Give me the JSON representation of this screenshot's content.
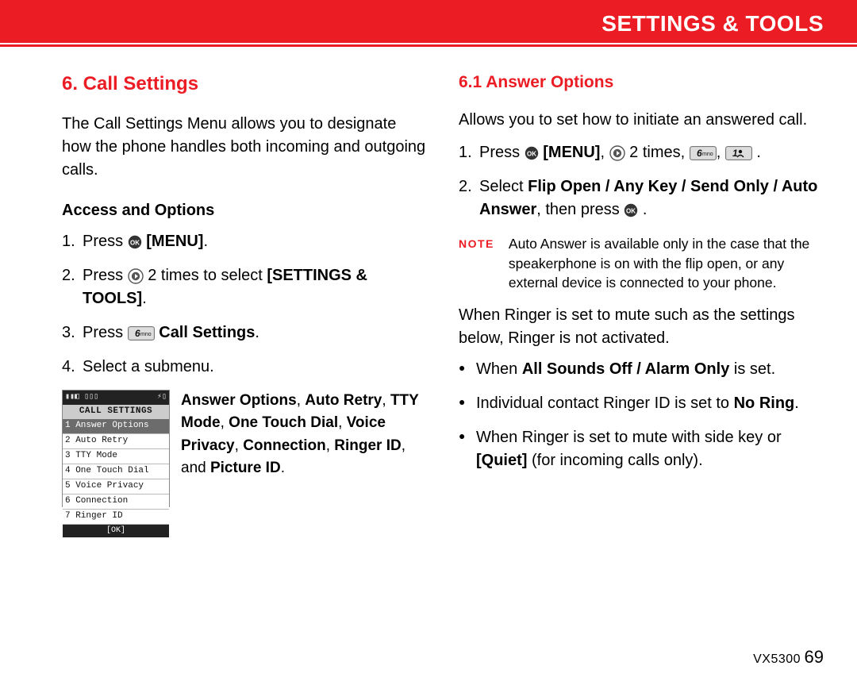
{
  "header": {
    "title": "SETTINGS & TOOLS"
  },
  "left": {
    "h2": "6. Call Settings",
    "intro": "The Call Settings Menu allows you to designate how the phone handles both incoming and outgoing calls.",
    "access_h": "Access and Options",
    "step1_a": "Press ",
    "step1_b": " [MENU]",
    "step1_c": ".",
    "step2_a": "Press ",
    "step2_b": " 2 times to select ",
    "step2_c": "[SETTINGS & TOOLS]",
    "step2_d": ".",
    "step3_a": "Press ",
    "step3_b": " Call Settings",
    "step3_c": ".",
    "step4": "Select a submenu.",
    "screenshot": {
      "top_left": "▮▮◧ ▯▯▯",
      "top_right": "⚡▯",
      "title": "CALL SETTINGS",
      "items": [
        "1  Answer Options",
        "2  Auto Retry",
        "3  TTY Mode",
        "4  One Touch Dial",
        "5  Voice Privacy",
        "6  Connection",
        "7  Ringer ID"
      ],
      "bottom": "[OK]"
    },
    "submenu_a": "Answer Options",
    "submenu_b": ", ",
    "submenu_c": "Auto Retry",
    "submenu_d": ", ",
    "submenu_e": "TTY Mode",
    "submenu_f": ", ",
    "submenu_g": "One Touch Dial",
    "submenu_h": ", ",
    "submenu_i": "Voice Privacy",
    "submenu_j": ", ",
    "submenu_k": "Connection",
    "submenu_l": ", ",
    "submenu_m": "Ringer ID",
    "submenu_n": ", and ",
    "submenu_o": "Picture ID",
    "submenu_p": "."
  },
  "right": {
    "h3": "6.1 Answer Options",
    "intro": "Allows you to set how to initiate an answered call.",
    "s1_a": "Press ",
    "s1_b": " [MENU]",
    "s1_c": ", ",
    "s1_d": " 2 times, ",
    "s1_e": ", ",
    "s1_f": " .",
    "s2_a": "Select ",
    "s2_b": "Flip Open / Any Key / Send Only / Auto Answer",
    "s2_c": ", then press ",
    "s2_d": " .",
    "note_label": "NOTE",
    "note_body": "Auto Answer is available only in the case that the speakerphone is on with the flip open, or any external device is connected to your phone.",
    "para2": "When Ringer is set to mute such as the settings below, Ringer is not activated.",
    "b1_a": "When ",
    "b1_b": "All Sounds Off / Alarm Only",
    "b1_c": " is set.",
    "b2_a": "Individual contact Ringer ID is set to ",
    "b2_b": "No Ring",
    "b2_c": ".",
    "b3_a": "When Ringer is set to mute with side key or ",
    "b3_b": "[Quiet]",
    "b3_c": " (for incoming calls only)."
  },
  "footer": {
    "model": "VX5300",
    "page": "69"
  }
}
